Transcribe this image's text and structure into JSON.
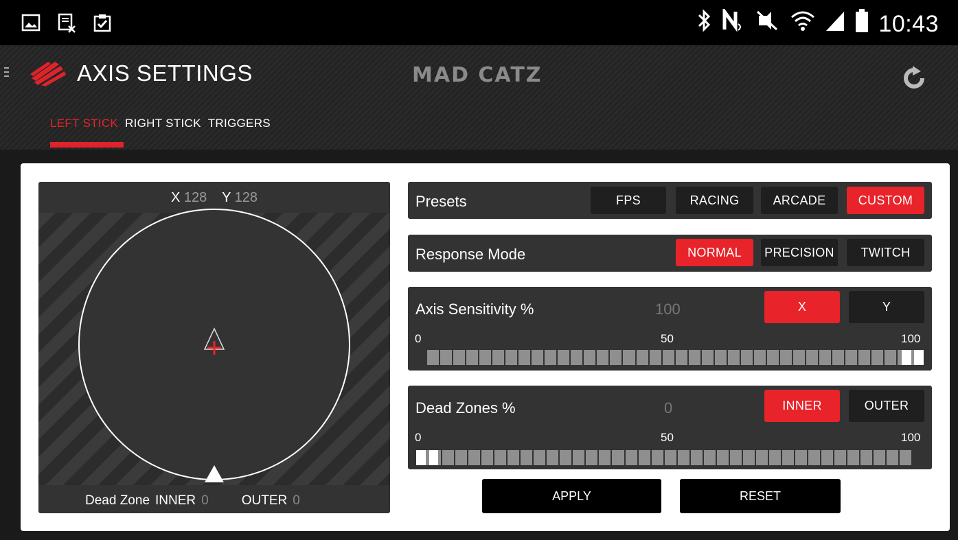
{
  "status_bar": {
    "time": "10:43",
    "left_icons": [
      "image-icon",
      "file-cancel-icon",
      "clipboard-check-icon"
    ],
    "right_icons": [
      "bluetooth-icon",
      "nfc-icon",
      "mute-icon",
      "wifi-icon",
      "signal-icon",
      "battery-icon"
    ]
  },
  "app": {
    "title": "AXIS SETTINGS",
    "brand": "MAD CATZ",
    "tabs": [
      {
        "label": "LEFT STICK",
        "active": true
      },
      {
        "label": "RIGHT STICK",
        "active": false
      },
      {
        "label": "TRIGGERS",
        "active": false
      }
    ]
  },
  "stick": {
    "x_label": "X",
    "x_value": "128",
    "y_label": "Y",
    "y_value": "128",
    "dead_zone_label": "Dead Zone",
    "inner_label": "INNER",
    "inner_value": "0",
    "outer_label": "OUTER",
    "outer_value": "0"
  },
  "presets": {
    "label": "Presets",
    "options": [
      "FPS",
      "RACING",
      "ARCADE",
      "CUSTOM"
    ],
    "selected": "CUSTOM"
  },
  "response_mode": {
    "label": "Response Mode",
    "options": [
      "NORMAL",
      "PRECISION",
      "TWITCH"
    ],
    "selected": "NORMAL"
  },
  "axis_sensitivity": {
    "label": "Axis Sensitivity %",
    "value": "100",
    "axis_options": [
      "X",
      "Y"
    ],
    "selected_axis": "X",
    "scale_min": "0",
    "scale_mid": "50",
    "scale_max": "100",
    "level_percent": 100
  },
  "dead_zones": {
    "label": "Dead Zones %",
    "value": "0",
    "zone_options": [
      "INNER",
      "OUTER"
    ],
    "selected_zone": "INNER",
    "scale_min": "0",
    "scale_mid": "50",
    "scale_max": "100",
    "level_percent": 0
  },
  "actions": {
    "apply": "APPLY",
    "reset": "RESET"
  },
  "colors": {
    "accent": "#e8232a",
    "panel": "#333333",
    "card": "#ffffff"
  }
}
